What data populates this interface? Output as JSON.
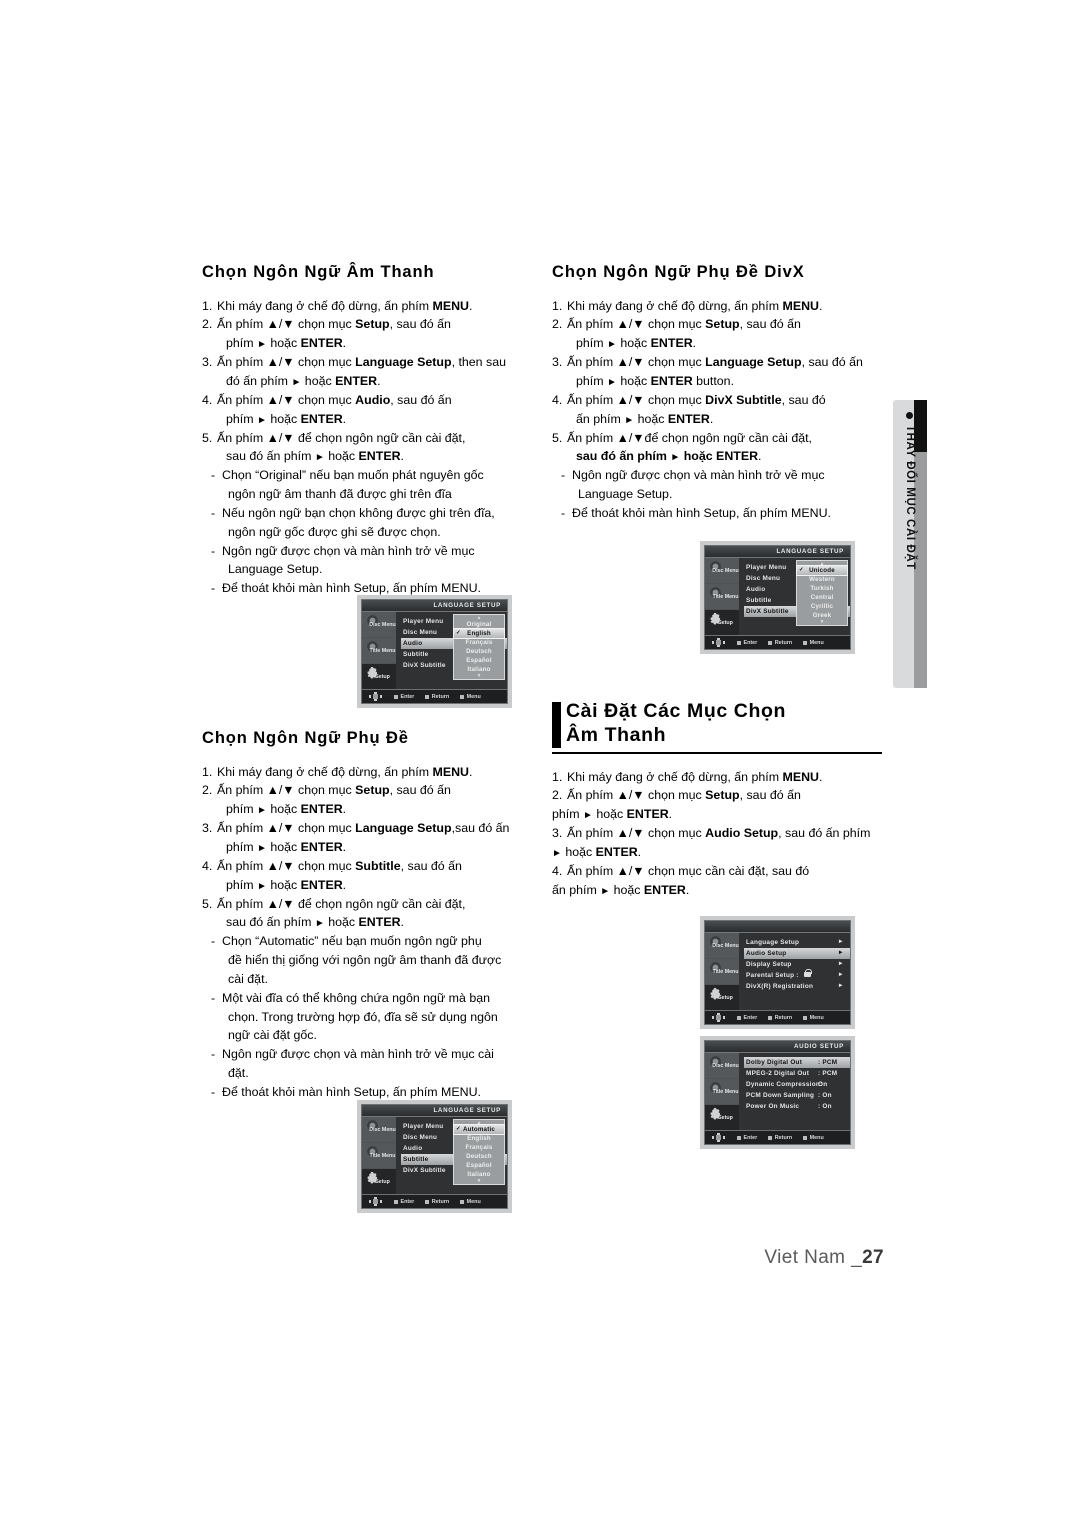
{
  "page": {
    "footer_label": "Viet Nam _",
    "footer_number": "27",
    "side_tab_text": "THAY ĐỔI MỤC CÀI ĐẶT"
  },
  "sections": {
    "audio_language": {
      "title": "Chọn Ngôn Ngữ Âm Thanh",
      "steps": [
        {
          "num": "1.",
          "line1": "Khi máy đang ở chế độ dừng, ấn phím MENU."
        },
        {
          "num": "2.",
          "line1": "Ấn phím ▲/▼ chọn mục Setup, sau đó ấn",
          "line2": "phím ► hoặc ENTER."
        },
        {
          "num": "3.",
          "line1": "Ấn phím ▲/▼ chọn mục Language Setup, then  sau",
          "line2": "đó ấn phím ► hoặc ENTER."
        },
        {
          "num": "4.",
          "line1": "Ấn phím ▲/▼ chọn mục Audio, sau đó ấn",
          "line2": "phím ► hoặc ENTER."
        },
        {
          "num": "5.",
          "line1": "Ấn phím ▲/▼ để chọn ngôn ngữ cần cài đặt,",
          "line2": "sau đó ấn phím ► hoặc ENTER."
        }
      ],
      "notes": [
        {
          "line1": "Chọn “Original” nếu bạn muốn phát nguyên gốc",
          "line2": "ngôn ngữ âm thanh đã được ghi trên đĩa"
        },
        {
          "line1": "Nếu ngôn ngữ bạn chọn không được ghi trên đĩa,",
          "line2": "ngôn ngữ gốc được ghi sẽ được chọn."
        },
        {
          "line1": "Ngôn ngữ được chọn và màn hình trở về mục",
          "line2": "Language Setup."
        },
        {
          "line1": "Để thoát khỏi màn hình Setup, ấn phím MENU.",
          "line2": ""
        }
      ]
    },
    "subtitle_language": {
      "title": "Chọn Ngôn Ngữ Phụ Đề",
      "steps": [
        {
          "num": "1.",
          "line1": "Khi máy đang ở chế độ dừng, ấn phím MENU."
        },
        {
          "num": "2.",
          "line1": "Ấn phím ▲/▼ chọn mục Setup, sau đó ấn",
          "line2": "phím ► hoặc ENTER."
        },
        {
          "num": "3.",
          "line1": "Ấn phím ▲/▼ chọn mục Language Setup,sau đó ấn",
          "line2": "phím ► hoặc ENTER."
        },
        {
          "num": "4.",
          "line1": "Ấn phím ▲/▼ chọn mục Subtitle, sau đó ấn",
          "line2": "phím ► hoặc ENTER."
        },
        {
          "num": "5.",
          "line1": "Ấn phím ▲/▼ để chọn ngôn ngữ cần cài đặt,",
          "line2": "sau đó ấn phím ► hoặc ENTER."
        }
      ],
      "notes": [
        {
          "line1": "Chọn “Automatic” nếu bạn muốn ngôn ngữ phụ",
          "line2": "đề hiển thị giống với ngôn ngữ âm thanh đã được",
          "line3": "cài đặt."
        },
        {
          "line1": "Một vài đĩa có thể không chứa ngôn ngữ mà bạn",
          "line2": "chọn. Trong trường hợp đó, đĩa sẽ sử dụng ngôn",
          "line3": "ngữ cài đặt gốc."
        },
        {
          "line1": "Ngôn ngữ được chọn và màn hình trở về mục cài",
          "line2": "đặt."
        },
        {
          "line1": "Để thoát khỏi màn hình Setup, ấn phím MENU.",
          "line2": ""
        }
      ]
    },
    "divx_subtitle": {
      "title": "Chọn Ngôn Ngữ Phụ Đề DivX",
      "steps": [
        {
          "num": "1.",
          "line1": "Khi máy đang ở chế độ dừng, ấn phím MENU."
        },
        {
          "num": "2.",
          "line1": "Ấn phím ▲/▼ chọn mục Setup, sau đó ấn",
          "line2": "phím ► hoặc ENTER."
        },
        {
          "num": "3.",
          "line1": "Ấn phím ▲/▼ chọn mục Language Setup, sau đó ấn",
          "line2": "phím ► hoặc ENTER button."
        },
        {
          "num": "4.",
          "line1": "Ấn phím ▲/▼ chọn mục DivX Subtitle, sau đó",
          "line2": "ấn phím ► hoặc ENTER."
        },
        {
          "num": "5.",
          "line1": "Ấn phím ▲/▼để chọn ngôn ngữ cần cài đặt,",
          "line2": "sau đó ấn phím ► hoặc ENTER."
        }
      ],
      "notes": [
        {
          "line1": "Ngôn ngữ được chọn và màn hình trở về mục",
          "line2": "Language Setup."
        },
        {
          "line1": "Để thoát khỏi màn hình Setup, ấn phím MENU.",
          "line2": ""
        }
      ]
    },
    "audio_options": {
      "title_line1": "Cài Đặt Các Mục Chọn",
      "title_line2": "Âm Thanh",
      "steps": [
        {
          "num": "1.",
          "line1": "Khi máy đang ở chế độ dừng, ấn phím MENU."
        },
        {
          "num": "2.",
          "line1": "Ấn phím ▲/▼ chọn mục Setup, sau đó ấn",
          "line2": "phím ► hoặc ENTER."
        },
        {
          "num": "3.",
          "line1": "Ấn phím ▲/▼ chọn mục Audio Setup, sau đó ấn phím",
          "line2": "► hoặc ENTER."
        },
        {
          "num": "4.",
          "line1": "Ấn phím ▲/▼ chọn mục cần cài đặt, sau đó",
          "line2": "ấn phím ► hoặc ENTER."
        }
      ]
    }
  },
  "osd_common": {
    "sidebar": [
      "Disc Menu",
      "Title Menu",
      "Setup"
    ],
    "footer_keys": [
      "Enter",
      "Return",
      "Menu"
    ]
  },
  "osd_screens": {
    "language_audio": {
      "title": "LANGUAGE SETUP",
      "rows": [
        "Player Menu",
        "Disc Menu",
        "Audio",
        "Subtitle",
        "DivX Subtitle"
      ],
      "selected_row": "Audio",
      "options": [
        "Original",
        "English",
        "Français",
        "Deutsch",
        "Español",
        "Italiano"
      ],
      "selected_option": "English"
    },
    "language_subtitle": {
      "title": "LANGUAGE SETUP",
      "rows": [
        "Player Menu",
        "Disc Menu",
        "Audio",
        "Subtitle",
        "DivX Subtitle"
      ],
      "selected_row": "Subtitle",
      "options": [
        "Automatic",
        "English",
        "Français",
        "Deutsch",
        "Español",
        "Italiano"
      ],
      "selected_option": "Automatic"
    },
    "language_divx": {
      "title": "LANGUAGE SETUP",
      "rows": [
        "Player Menu",
        "Disc Menu",
        "Audio",
        "Subtitle",
        "DivX Subtitle"
      ],
      "selected_row": "DivX Subtitle",
      "options": [
        "Unicode",
        "Western",
        "Turkish",
        "Central",
        "Cyrillic",
        "Greek"
      ],
      "selected_option": "Unicode"
    },
    "setup_main": {
      "title": "",
      "rows": [
        "Language Setup",
        "Audio Setup",
        "Display Setup",
        "Parental Setup :",
        "DivX(R) Registration"
      ],
      "selected_row": "Audio Setup"
    },
    "audio_setup": {
      "title": "AUDIO SETUP",
      "rows": [
        {
          "label": "Dolby Digital Out",
          "value": ": PCM"
        },
        {
          "label": "MPEG-2 Digital Out",
          "value": ": PCM"
        },
        {
          "label": "Dynamic Compression:",
          "value": "On"
        },
        {
          "label": "PCM Down Sampling",
          "value": ": On"
        },
        {
          "label": "Power On Music",
          "value": ": On"
        }
      ],
      "selected_row": "Dolby Digital Out"
    }
  }
}
